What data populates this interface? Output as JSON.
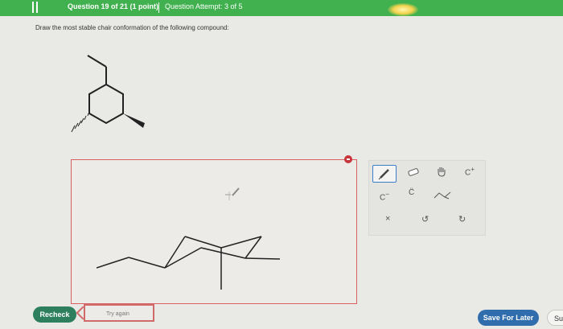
{
  "header": {
    "question": "Question 19 of 21 (1 point)",
    "attempt": "Question Attempt: 3 of 5"
  },
  "prompt": "Draw the most stable chair conformation of the following compound:",
  "toolbox": {
    "c_plus": "C",
    "c_plus_sup": "+",
    "c_minus": "C",
    "c_minus_sup": "−",
    "c_dots": "C̈",
    "x": "×",
    "undo": "↺",
    "redo": "↻"
  },
  "buttons": {
    "recheck": "Recheck",
    "try_again": "Try again",
    "save_later": "Save For Later",
    "submit": "Su"
  },
  "colors": {
    "header_green": "#41b04f",
    "recheck_green": "#2d7f5e",
    "save_blue": "#2f6dac",
    "error_red": "#d06a6a"
  }
}
